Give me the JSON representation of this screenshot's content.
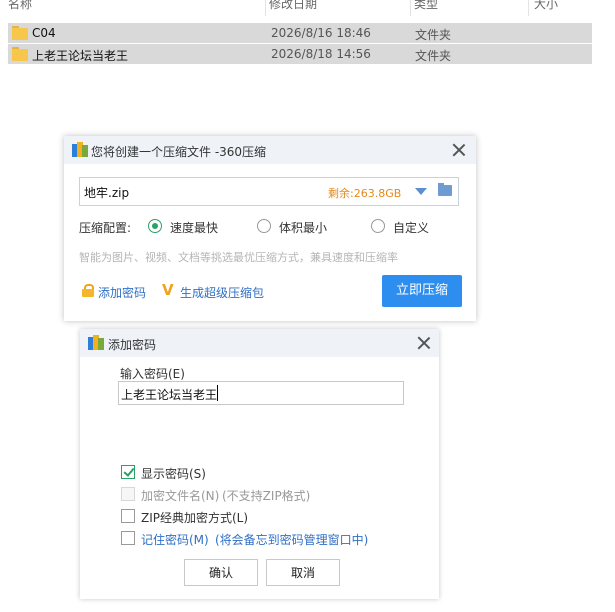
{
  "explorer": {
    "columns": {
      "name": "名称",
      "date": "修改日期",
      "type": "类型",
      "size": "大小"
    },
    "rows": [
      {
        "name": "C04",
        "date": "2026/8/16 18:46",
        "type": "文件夹"
      },
      {
        "name": "上老王论坛当老王",
        "date": "2026/8/18 14:56",
        "type": "文件夹"
      }
    ]
  },
  "compress_dialog": {
    "title": "您将创建一个压缩文件 -360压缩",
    "filename": "地牢.zip",
    "free_space": "剩余:263.8GB",
    "config_label": "压缩配置:",
    "options": [
      "速度最快",
      "体积最小",
      "自定义"
    ],
    "selected_option": "速度最快",
    "hint": "智能为图片、视频、文档等挑选最优压缩方式，兼具速度和压缩率",
    "add_password_link": "添加密码",
    "super_pack_link": "生成超级压缩包",
    "compress_button": "立即压缩"
  },
  "password_dialog": {
    "title": "添加密码",
    "input_label": "输入密码(E)",
    "password_value": "上老王论坛当老王",
    "show_password": {
      "label": "显示密码(S)",
      "checked": true
    },
    "encrypt_filename": {
      "label": "加密文件名(N)",
      "note": "(不支持ZIP格式)",
      "enabled": false
    },
    "zip_classic": {
      "label": "ZIP经典加密方式(L)",
      "checked": false
    },
    "remember": {
      "label": "记住密码(M)",
      "note": "(将会备忘到密码管理窗口中)",
      "checked": false
    },
    "ok_button": "确认",
    "cancel_button": "取消"
  },
  "colors": {
    "accent": "#2e8ef0",
    "check": "#2aa06a",
    "free_space": "#e38a1b",
    "link": "#2f6fc6"
  }
}
